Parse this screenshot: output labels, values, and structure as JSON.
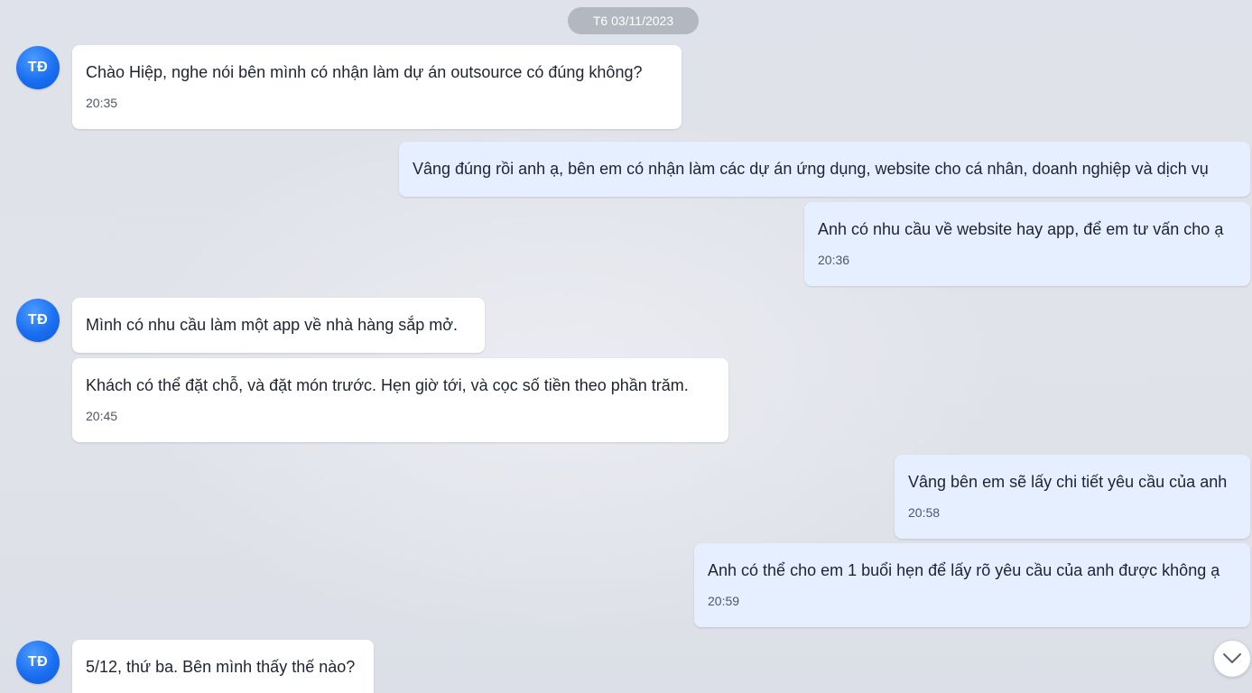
{
  "date_divider": "T6 03/11/2023",
  "contact": {
    "initials": "TĐ"
  },
  "messages": [
    {
      "text": "Chào Hiệp, nghe nói bên mình có nhận làm dự án outsource có đúng không?",
      "time": "20:35"
    },
    {
      "text": "Vâng đúng rồi anh ạ, bên em có nhận làm các dự án ứng dụng, website cho cá nhân, doanh nghiệp và dịch vụ"
    },
    {
      "text": "Anh có nhu cầu về website hay app, để em tư vấn cho ạ",
      "time": "20:36"
    },
    {
      "text": "Mình có nhu cầu làm một app về nhà hàng sắp mở."
    },
    {
      "text": "Khách có thể đặt chỗ, và đặt món trước. Hẹn giờ tới, và cọc số tiền theo phần trăm.",
      "time": "20:45"
    },
    {
      "text": "Vâng bên em sẽ lấy chi tiết yêu cầu của anh",
      "time": "20:58"
    },
    {
      "text": "Anh có thể cho em 1 buổi hẹn để lấy rõ yêu cầu của anh được không ạ",
      "time": "20:59"
    },
    {
      "text": "5/12, thứ ba. Bên mình thấy thế nào?"
    }
  ],
  "scroll_button": {
    "icon": "chevron-down-icon"
  },
  "colors": {
    "incoming_bubble": "#ffffff",
    "outgoing_bubble": "#e5efff",
    "avatar": "#1a6ff0",
    "date_pill": "#b3b7bf",
    "background": "#dde0e8"
  }
}
